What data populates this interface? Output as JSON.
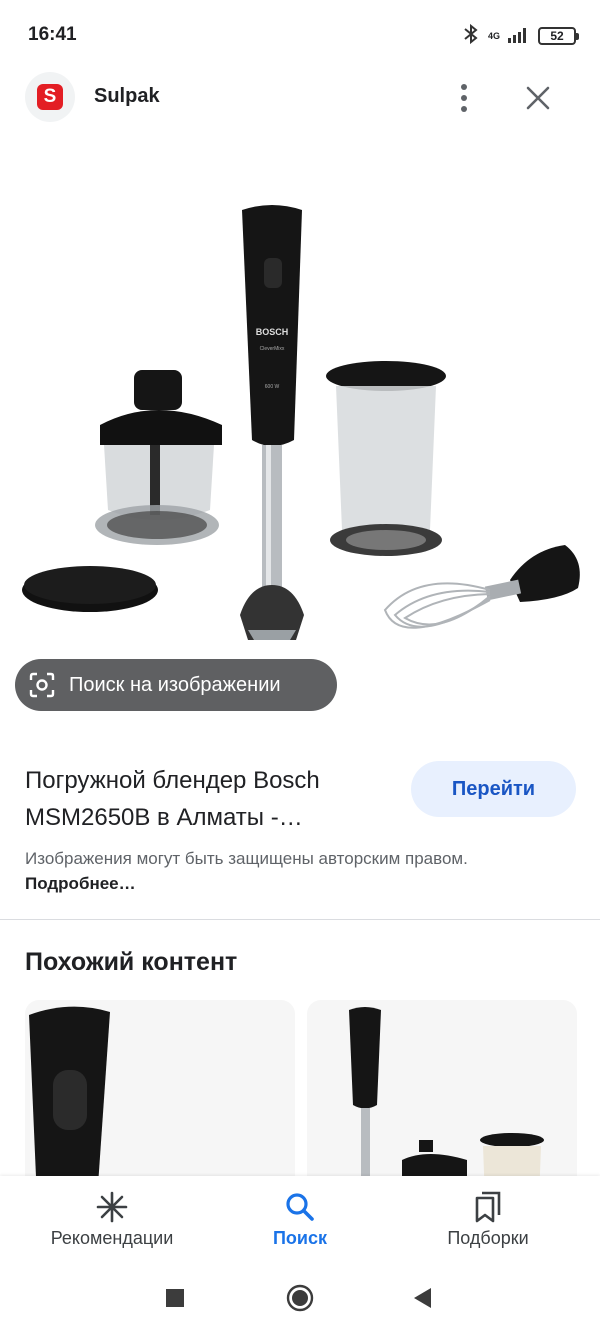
{
  "status_bar": {
    "time": "16:41",
    "network": "4G",
    "battery": "52",
    "icons": [
      "bluetooth-icon",
      "signal-icon",
      "battery-icon"
    ]
  },
  "app_bar": {
    "site_name": "Sulpak",
    "logo_letter": "S",
    "icons": [
      "more-vert-icon",
      "close-icon"
    ]
  },
  "lens_chip": {
    "label": "Поиск на изображении",
    "icon": "lens-icon"
  },
  "result": {
    "title": "Погружной блендер Bosch MSM2650B в Алматы -…",
    "goto_label": "Перейти",
    "copyright_text": "Изображения могут быть защищены авторским правом.",
    "more_link": "Подробнее…"
  },
  "similar": {
    "title": "Похожий контент"
  },
  "bottom_nav": {
    "items": [
      {
        "label": "Рекомендации",
        "icon": "asterisk-icon"
      },
      {
        "label": "Поиск",
        "icon": "search-icon",
        "active": true
      },
      {
        "label": "Подборки",
        "icon": "collections-icon"
      }
    ]
  },
  "product_label": {
    "brand": "BOSCH",
    "model": "CleverMixx",
    "power": "600 W"
  },
  "colors": {
    "accent": "#1a73e8",
    "goto_bg": "#e8f0fe",
    "chip_bg": "#5f6062",
    "brand_red": "#e31e24"
  }
}
